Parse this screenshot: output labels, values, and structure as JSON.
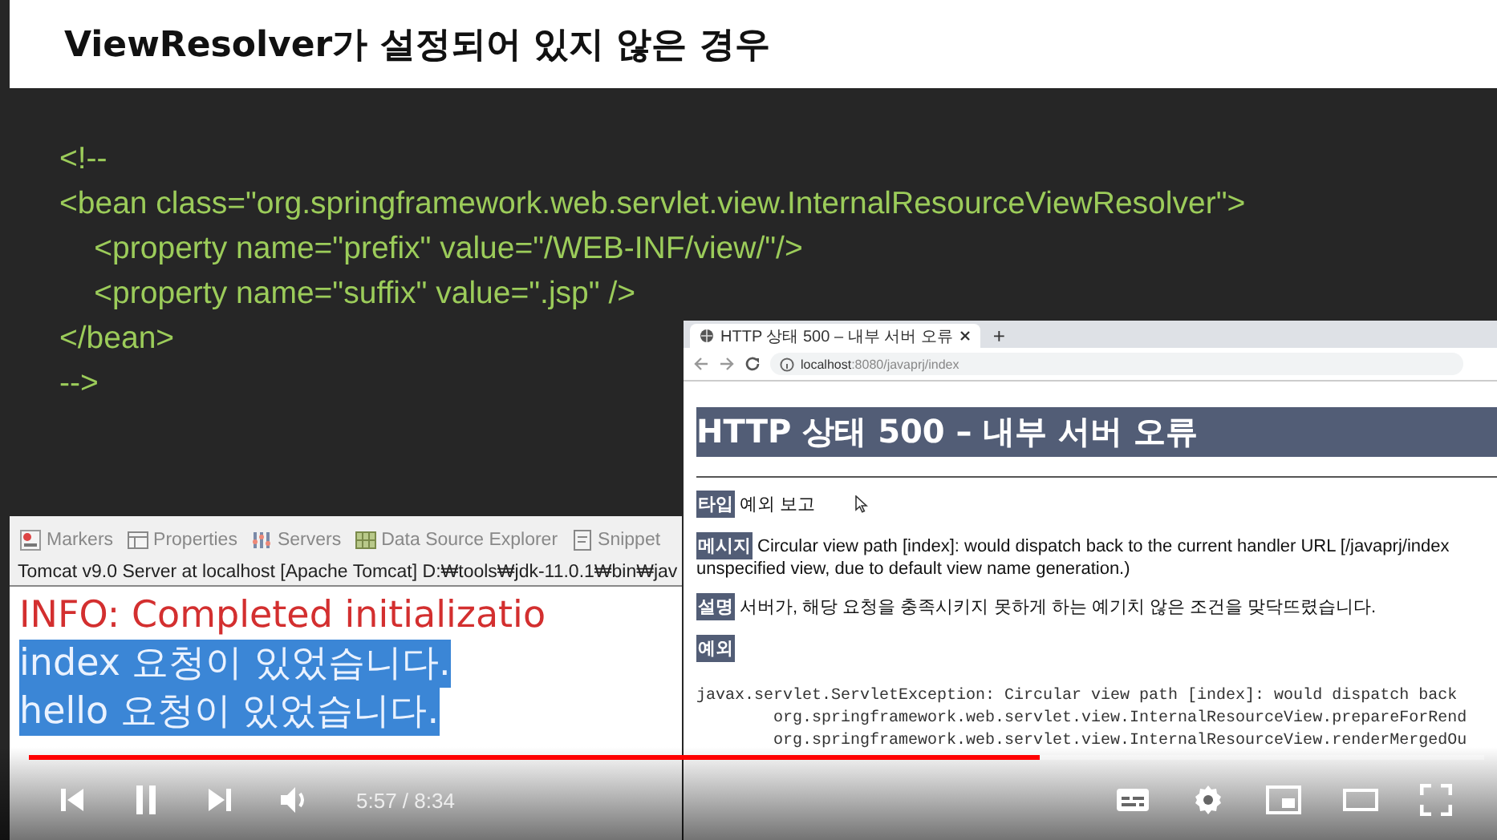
{
  "slide": {
    "title": "ViewResolver가 설정되어 있지 않은 경우",
    "code_lines": [
      "<!--",
      "<bean class=\"org.springframework.web.servlet.view.InternalResourceViewResolver\">",
      "    <property name=\"prefix\" value=\"/WEB-INF/view/\"/>",
      "    <property name=\"suffix\" value=\".jsp\" />",
      "</bean>",
      "-->"
    ]
  },
  "console": {
    "tabs": [
      {
        "label": "Markers",
        "kind": "markers"
      },
      {
        "label": "Properties",
        "kind": "properties"
      },
      {
        "label": "Servers",
        "kind": "servers"
      },
      {
        "label": "Data Source Explorer",
        "kind": "datasource"
      },
      {
        "label": "Snippet",
        "kind": "snippet"
      }
    ],
    "title": "Tomcat v9.0 Server at localhost [Apache Tomcat] D:₩tools₩jdk-11.0.1₩bin₩jav",
    "lines": [
      {
        "text": "INFO: Completed initializatio",
        "kind": "info",
        "selected": false
      },
      {
        "text": "index 요청이 있었습니다.",
        "kind": "output",
        "selected": true
      },
      {
        "text": "hello 요청이 있었습니다.",
        "kind": "output",
        "selected": true
      }
    ]
  },
  "browser": {
    "tab_title": "HTTP 상태 500 – 내부 서버 오류",
    "new_tab": "+",
    "address_host": "localhost",
    "address_path": ":8080/javaprj/index",
    "heading": "HTTP 상태 500 – 내부 서버 오류",
    "sections": [
      {
        "label": "타입",
        "lines": [
          "예외 보고"
        ]
      },
      {
        "label": "메시지",
        "lines": [
          "Circular view path [index]: would dispatch back to the current handler URL [/javaprj/index",
          "unspecified view, due to default view name generation.)"
        ]
      },
      {
        "label": "설명",
        "lines": [
          "서버가, 해당 요청을 충족시키지 못하게 하는 예기치 않은 조건을 맞닥뜨렸습니다."
        ]
      },
      {
        "label": "예외"
      }
    ],
    "stack_trace": [
      "javax.servlet.ServletException: Circular view path [index]: would dispatch back",
      "        org.springframework.web.servlet.view.InternalResourceView.prepareForRend",
      "        org.springframework.web.servlet.view.InternalResourceView.renderMergedOu"
    ]
  },
  "player": {
    "playing": true,
    "progress": {
      "level": 0.695
    },
    "time": "5:57 / 8:34"
  }
}
